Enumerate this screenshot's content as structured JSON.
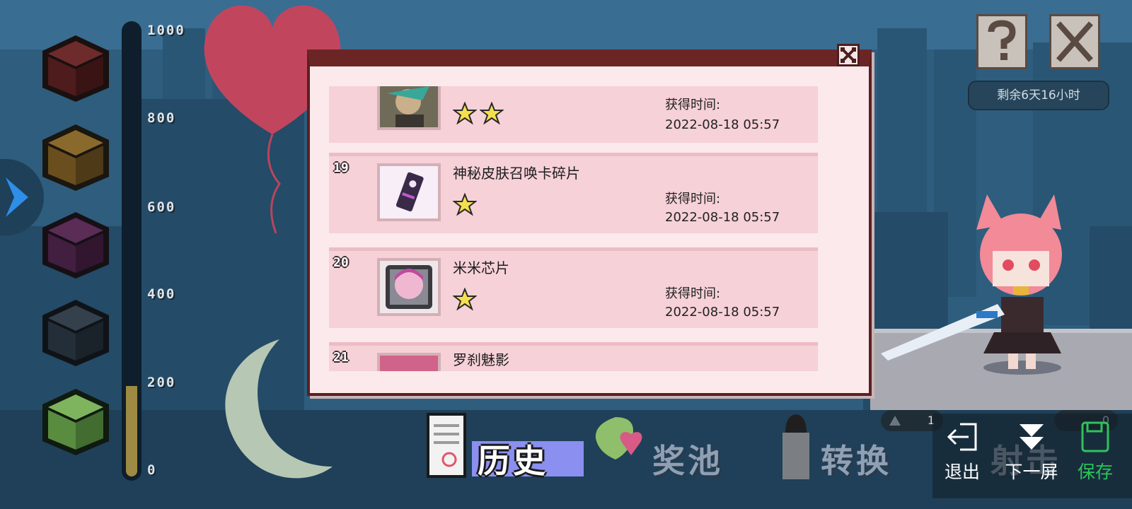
{
  "colors": {
    "dialog_header": "#6b2525",
    "row_bg": "#f6d1d8",
    "star": "#f4e04d",
    "history_tab": "#8a8ff0",
    "save_green": "#2ec35a"
  },
  "progress_bar": {
    "ticks": [
      "1000",
      "800",
      "600",
      "400",
      "200",
      "0"
    ],
    "level_fraction": 0.2
  },
  "chests": [
    {
      "icon": "chest-red-icon"
    },
    {
      "icon": "chest-gold-icon"
    },
    {
      "icon": "chest-purple-icon"
    },
    {
      "icon": "chest-dark-icon"
    },
    {
      "icon": "chest-green-icon"
    }
  ],
  "top_right": {
    "help_icon": "question-icon",
    "close_icon": "close-icon",
    "timer": "剩余6天16小时"
  },
  "dialog": {
    "close_icon": "close-icon",
    "rows": [
      {
        "index": "",
        "name": "",
        "stars": 2,
        "time_label": "获得时间:",
        "time": "2022-08-18 05:57",
        "thumb": "hero-portrait"
      },
      {
        "index": "19",
        "name": "神秘皮肤召唤卡碎片",
        "stars": 1,
        "time_label": "获得时间:",
        "time": "2022-08-18 05:57",
        "thumb": "summon-card-fragment"
      },
      {
        "index": "20",
        "name": "米米芯片",
        "stars": 1,
        "time_label": "获得时间:",
        "time": "2022-08-18 05:57",
        "thumb": "chip"
      },
      {
        "index": "21",
        "name": "罗刹魅影",
        "stars": 0,
        "time_label": "",
        "time": "",
        "thumb": "pink-hair-portrait"
      }
    ]
  },
  "tabs": {
    "history": "历史",
    "pool": "奖池",
    "convert": "转换",
    "shoot": "射击"
  },
  "counters": {
    "left": "1",
    "right": "0"
  },
  "system_buttons": {
    "exit": "退出",
    "next_screen": "下一屏",
    "save": "保存"
  }
}
